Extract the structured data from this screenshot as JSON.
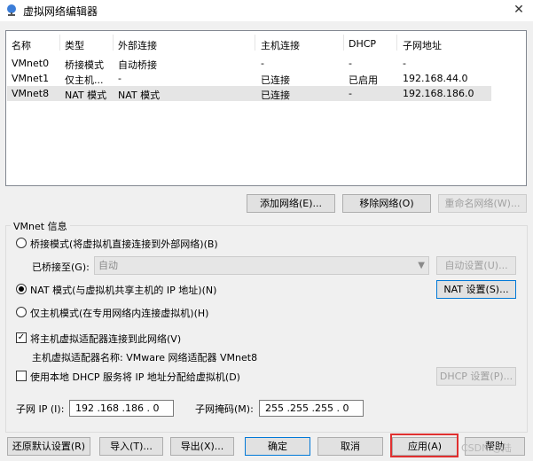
{
  "window": {
    "title": "虚拟网络编辑器",
    "close_glyph": "✕"
  },
  "table": {
    "headers": [
      "名称",
      "类型",
      "外部连接",
      "主机连接",
      "DHCP",
      "子网地址"
    ],
    "rows": [
      [
        "VMnet0",
        "桥接模式",
        "自动桥接",
        "-",
        "-",
        "-"
      ],
      [
        "VMnet1",
        "仅主机...",
        "-",
        "已连接",
        "已启用",
        "192.168.44.0"
      ],
      [
        "VMnet8",
        "NAT 模式",
        "NAT 模式",
        "已连接",
        "-",
        "192.168.186.0"
      ]
    ],
    "selected_row": 2
  },
  "table_buttons": {
    "add": "添加网络(E)...",
    "remove": "移除网络(O)",
    "rename": "重命名网络(W)..."
  },
  "vmnet_info": {
    "group_label": "VMnet 信息",
    "bridged_label": "桥接模式(将虚拟机直接连接到外部网络)(B)",
    "bridged_to_label": "已桥接至(G):",
    "bridged_to_value": "自动",
    "auto_settings": "自动设置(U)...",
    "nat_label": "NAT 模式(与虚拟机共享主机的 IP 地址)(N)",
    "nat_settings": "NAT 设置(S)...",
    "hostonly_label": "仅主机模式(在专用网络内连接虚拟机)(H)",
    "selected_mode": "nat",
    "connect_adapter_label": "将主机虚拟适配器连接到此网络(V)",
    "connect_adapter_checked": true,
    "adapter_name_label": "主机虚拟适配器名称: VMware 网络适配器 VMnet8",
    "dhcp_label": "使用本地 DHCP 服务将 IP 地址分配给虚拟机(D)",
    "dhcp_checked": false,
    "dhcp_settings": "DHCP 设置(P)...",
    "subnet_ip_label": "子网 IP (I):",
    "subnet_ip_value": "192 .168 .186 . 0",
    "subnet_mask_label": "子网掩码(M):",
    "subnet_mask_value": "255 .255 .255 . 0"
  },
  "footer": {
    "restore": "还原默认设置(R)",
    "import": "导入(T)...",
    "export": "导出(X)...",
    "ok": "确定",
    "cancel": "取消",
    "apply": "应用(A)",
    "help": "帮助"
  },
  "watermark": "CSDN @陆"
}
